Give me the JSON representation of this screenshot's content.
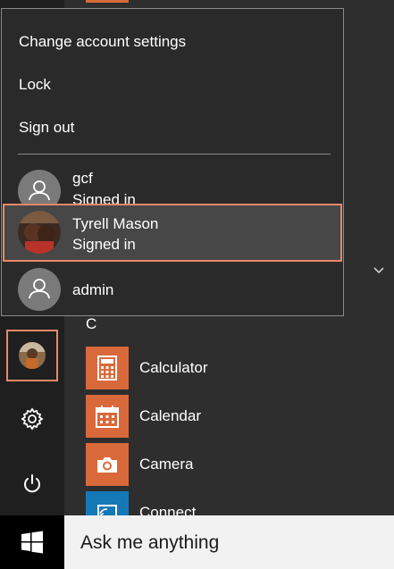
{
  "flyout": {
    "menu": {
      "change_account_settings": "Change account settings",
      "lock": "Lock",
      "sign_out": "Sign out"
    },
    "users": [
      {
        "name": "gcf",
        "status": "Signed in"
      },
      {
        "name": "Tyrell Mason",
        "status": "Signed in"
      },
      {
        "name": "admin",
        "status": ""
      }
    ]
  },
  "apps": {
    "section_letter": "C",
    "items": [
      {
        "label": "Calculator",
        "icon": "calculator-icon"
      },
      {
        "label": "Calendar",
        "icon": "calendar-icon"
      },
      {
        "label": "Camera",
        "icon": "camera-icon"
      },
      {
        "label": "Connect",
        "icon": "connect-icon"
      }
    ]
  },
  "taskbar": {
    "search_text": "Ask me anything"
  },
  "colors": {
    "accent": "#e8896a",
    "tile_orange": "#d9693a",
    "tile_blue": "#1579b8"
  }
}
